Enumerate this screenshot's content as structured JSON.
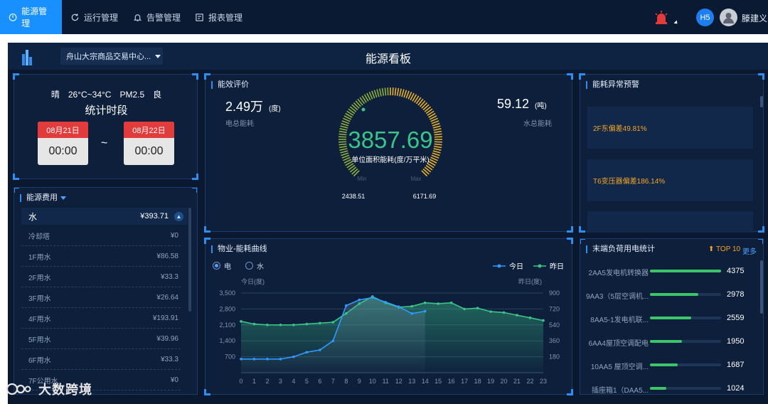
{
  "nav": {
    "items": [
      {
        "label": "能源管理",
        "icon": "energy-icon",
        "active": true
      },
      {
        "label": "运行管理",
        "icon": "refresh-icon",
        "active": false
      },
      {
        "label": "告警管理",
        "icon": "bell-icon",
        "active": false
      },
      {
        "label": "报表管理",
        "icon": "report-icon",
        "active": false
      }
    ],
    "alarm_icon": "siren-icon",
    "badge": "H5",
    "user": "滕建义"
  },
  "header": {
    "site": "舟山大宗商品交易中心...",
    "title": "能源看板"
  },
  "stats_period": {
    "weather": "晴　26°C~34°C　PM2.5　良",
    "title": "统计时段",
    "start_label": "08月21日",
    "start_time": "00:00",
    "sep": "~",
    "end_label": "08月22日",
    "end_time": "00:00"
  },
  "cost": {
    "title": "能源费用",
    "category": "水",
    "category_total": "¥393.71",
    "rows": [
      {
        "name": "冷却塔",
        "value": "¥0"
      },
      {
        "name": "1F用水",
        "value": "¥86.58"
      },
      {
        "name": "2F用水",
        "value": "¥33.3"
      },
      {
        "name": "3F用水",
        "value": "¥26.64"
      },
      {
        "name": "4F用水",
        "value": "¥193.91"
      },
      {
        "name": "5F用水",
        "value": "¥39.96"
      },
      {
        "name": "6F用水",
        "value": "¥33.3"
      },
      {
        "name": "7F公用水",
        "value": "¥0"
      }
    ]
  },
  "efficiency": {
    "title": "能效评价",
    "elec_value": "2.49万",
    "elec_unit": "(度)",
    "elec_label": "电总能耗",
    "water_value": "59.12",
    "water_unit": "(吨)",
    "water_label": "水总能耗",
    "gauge_value": "3857.69",
    "gauge_label": "单位面积能耗(度/万平米)",
    "min_label": "Min",
    "max_label": "Max",
    "min_value": "2438.51",
    "max_value": "6171.69"
  },
  "warnings": {
    "title": "能耗异常预警",
    "items": [
      "2F东偏差49.81%",
      "T6变压器偏差186.14%"
    ]
  },
  "curve": {
    "title": "物业-能耗曲线",
    "radios": [
      "电",
      "水"
    ],
    "legend": [
      "今日",
      "昨日"
    ],
    "left_unit": "今日(度)",
    "right_unit": "昨日(度)"
  },
  "ranking": {
    "title": "末端负荷用电统计",
    "top_label": "TOP 10",
    "more_label": "更多",
    "items": [
      {
        "name": "2AA5发电机转换器",
        "value": 4375
      },
      {
        "name": "9AA3（5层空调机...",
        "value": 2978
      },
      {
        "name": "8AA5-1发电机联...",
        "value": 2559
      },
      {
        "name": "6AA4屋顶空调配电",
        "value": 1950
      },
      {
        "name": "10AA5 屋顶空调...",
        "value": 1687
      },
      {
        "name": "插座箱1（DAA5...",
        "value": 1024
      }
    ]
  },
  "watermark": "大数跨境",
  "colors": {
    "accent": "#1890ff",
    "today": "#2f9bff",
    "yesterday": "#3ac48a",
    "warning": "#f5a623",
    "alarm": "#e23b3b"
  },
  "chart_data": {
    "type": "line",
    "x": [
      0,
      1,
      2,
      3,
      4,
      5,
      6,
      7,
      8,
      9,
      10,
      11,
      12,
      13,
      14,
      15,
      16,
      17,
      18,
      19,
      20,
      21,
      22,
      23
    ],
    "series": [
      {
        "name": "今日",
        "axis": "left",
        "values": [
          600,
          600,
          600,
          600,
          700,
          900,
          1000,
          1400,
          2950,
          3200,
          3300,
          3100,
          2900,
          2600,
          2700
        ]
      },
      {
        "name": "昨日",
        "axis": "right",
        "values": [
          580,
          550,
          540,
          540,
          540,
          550,
          560,
          570,
          670,
          780,
          860,
          790,
          740,
          750,
          790,
          780,
          790,
          720,
          730,
          690,
          680,
          650,
          620,
          590
        ]
      }
    ],
    "y_left": {
      "ticks": [
        700,
        1400,
        2100,
        2800,
        3500
      ],
      "range": [
        0,
        3500
      ]
    },
    "y_right": {
      "ticks": [
        180,
        360,
        540,
        720,
        900
      ],
      "range": [
        0,
        900
      ]
    },
    "ylabel_left": "今日(度)",
    "ylabel_right": "昨日(度)"
  }
}
